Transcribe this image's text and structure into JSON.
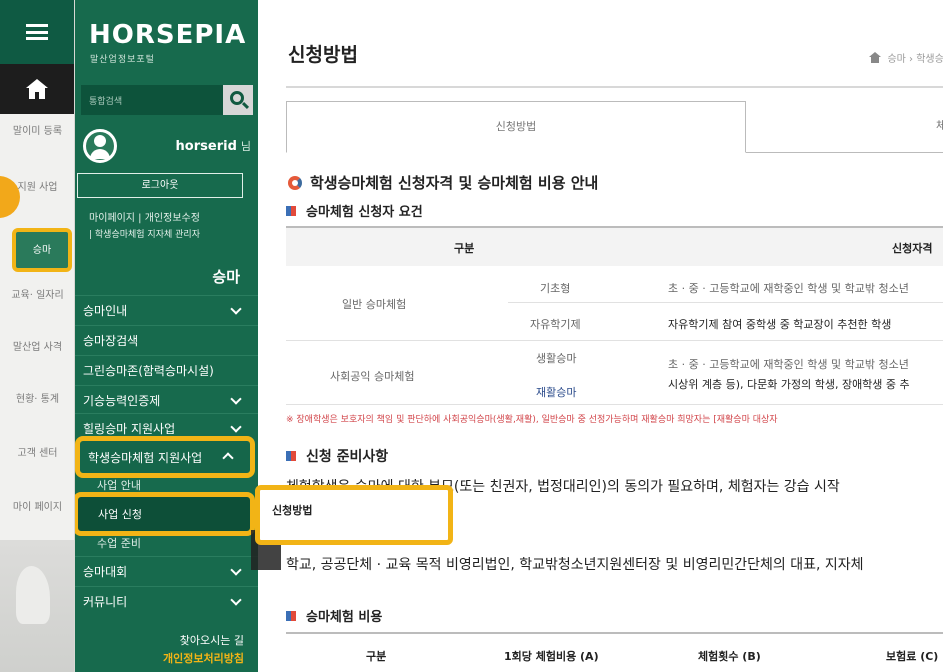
{
  "rail": {
    "items": [
      "말이미 등록",
      "지원 사업",
      "승마",
      "교육· 일자리",
      "말산업 사격",
      "현황· 통계",
      "고객 센터",
      "마이 페이지"
    ]
  },
  "nav": {
    "logo": "HORSEPIA",
    "logo_sub": "말산업정보포털",
    "search_placeholder": "통합검색",
    "username": "horserid",
    "username_suffix": "님",
    "logout": "로그아웃",
    "links_line1": "마이페이지 | 개인정보수정",
    "links_line2": "| 학생승마체험 지자체 관리자",
    "section": "승마",
    "items": [
      {
        "label": "승마인내"
      },
      {
        "label": "승마장검색"
      },
      {
        "label": "그린승마존(함력승마시설)"
      },
      {
        "label": "기승능력인증제"
      },
      {
        "label": "힐링승마 지원사업"
      },
      {
        "label": "학생승마체험 지원사업"
      },
      {
        "label": "승마대회"
      },
      {
        "label": "커뮤니티"
      }
    ],
    "sub_items": [
      "사업 안내",
      "사업 신청",
      "수업 준비"
    ],
    "footer_line1": "찾아오시는 길",
    "footer_line2": "개인정보처리방침"
  },
  "main": {
    "page_title": "신청방법",
    "breadcrumb": "승마 › 학생승마",
    "tab_active": "신청방법",
    "tab_next": "체",
    "section_title": "학생승마체험 신청자격 및 승마체험 비용 안내",
    "req_title": "승마체험 신청자 요건",
    "table": {
      "header_left": "구분",
      "header_right": "신청자격",
      "rows": [
        {
          "group": "일반 승마체험",
          "type": "기초형",
          "desc": "초 · 중 · 고등학교에 재학중인 학생 및 학교밖 청소년"
        },
        {
          "group": "",
          "type": "자유학기제",
          "desc": "자유학기제 참여 중학생 중 학교장이 추천한 학생"
        },
        {
          "group": "사회공익 승마체험",
          "type": "생활승마",
          "desc": "초 · 중 · 고등학교에 재학중인 학생 및 학교밖 청소년"
        },
        {
          "group": "",
          "type": "재활승마",
          "desc": "시상위 계층 등), 다문화 가정의 학생, 장애학생 중 추"
        }
      ]
    },
    "note": "※ 장애학생은 보호자의 책임 및 판단하에 사회공익승마(생활,재활), 일반승마 중 선정가능하며 재활승마 희망자는 [재활승마 대상자",
    "prep_title": "신청 준비사항",
    "prep_text": "체험학생은 승마에 대한 부모(또는 친권자, 법정대리인)의 동의가 필요하며, 체험자는 강습 시작",
    "prep_text2": "학교, 공공단체 · 교육 목적 비영리법인, 학교밖청소년지원센터장 및 비영리민간단체의 대표, 지자체",
    "fee_title": "승마체험 비용",
    "fee_headers": [
      "구분",
      "1회당 체험비용 (A)",
      "체험횟수 (B)",
      "보험료 (C)"
    ]
  },
  "popup": {
    "label": "신청방법"
  },
  "colors": {
    "nav_green": "#176a4d",
    "highlight": "#f2b416",
    "note_red": "#d2464b"
  }
}
